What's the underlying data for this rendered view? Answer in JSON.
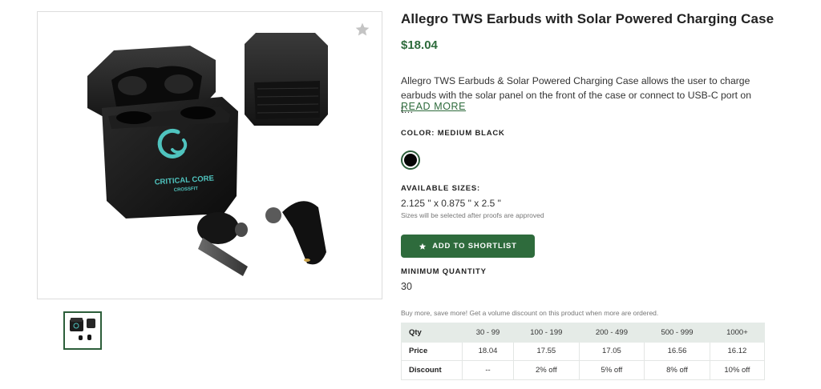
{
  "product": {
    "title": "Allegro TWS Earbuds with Solar Powered Charging Case",
    "price": "$18.04",
    "description": "Allegro TWS Earbuds & Solar Powered Charging Case allows the user to charge earbuds with the solar panel on the front of the case or connect to USB-C port on t…",
    "read_more": "READ MORE",
    "image_logo_line1": "CRITICAL CORE",
    "image_logo_line2": "CROSSFIT"
  },
  "color": {
    "label": "COLOR: MEDIUM BLACK",
    "swatch_hex": "#050505"
  },
  "sizes": {
    "label": "AVAILABLE SIZES:",
    "value": "2.125 \" x 0.875 \" x 2.5 \"",
    "note": "Sizes will be selected after proofs are approved"
  },
  "shortlist": {
    "label": "ADD TO SHORTLIST"
  },
  "min_qty": {
    "label": "MINIMUM QUANTITY",
    "value": "30"
  },
  "volume": {
    "note": "Buy more, save more! Get a volume discount on this product when more are ordered.",
    "rows": [
      [
        "Qty",
        "30 - 99",
        "100 - 199",
        "200 - 499",
        "500 - 999",
        "1000+"
      ],
      [
        "Price",
        "18.04",
        "17.55",
        "17.05",
        "16.56",
        "16.12"
      ],
      [
        "Discount",
        "--",
        "2% off",
        "5% off",
        "8% off",
        "10% off"
      ]
    ]
  },
  "colors": {
    "accent": "#2e6b3c",
    "header_bg": "#e5ebe7"
  }
}
